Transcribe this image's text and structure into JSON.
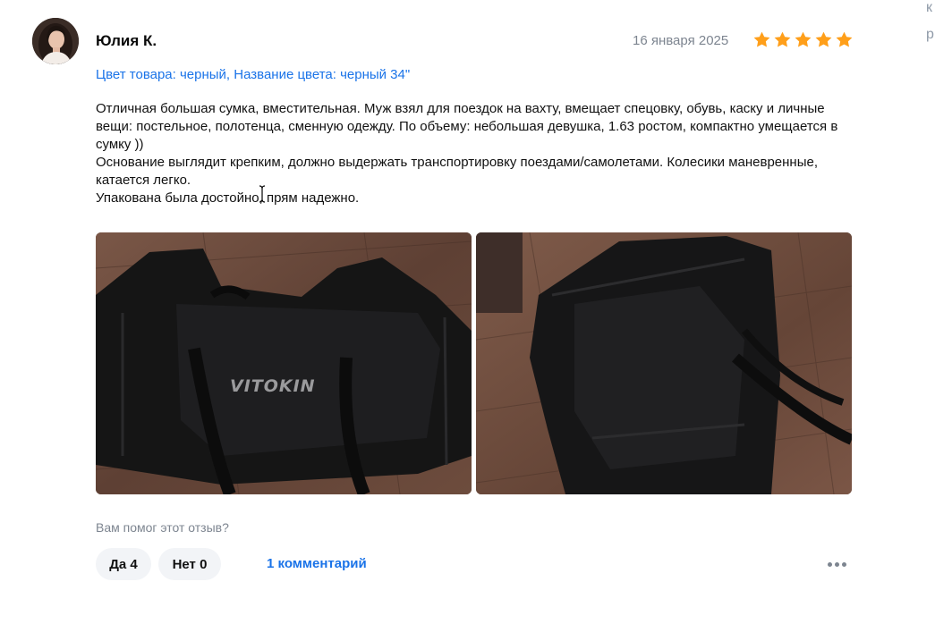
{
  "edge": {
    "line1": "к",
    "line2": "р"
  },
  "review": {
    "author": "Юлия К.",
    "date": "16 января 2025",
    "rating": 5,
    "star_color": "#ff9f1a",
    "variant": "Цвет товара: черный, Название цвета: черный 34\"",
    "text": {
      "p1": "Отличная большая сумка, вместительная. Муж взял для поездок на вахту, вмещает спецовку, обувь, каску и личные вещи: постельное, полотенца, сменную одежду. По объему: небольшая девушка, 1.63 ростом, компактно умещается в сумку ))",
      "p2": "Основание выглядит крепким, должно выдержать транспортировку поездами/самолетами. Колесики маневренные, катается легко.",
      "p3": "Упакована была достойно, прям надежно."
    },
    "photos": [
      {
        "brand_text": "VITOKIN"
      },
      {
        "brand_text": ""
      }
    ]
  },
  "feedback": {
    "question": "Вам помог этот отзыв?",
    "yes_label": "Да 4",
    "no_label": "Нет 0",
    "comments_label": "1 комментарий",
    "more_icon": "more-dots-icon"
  },
  "colors": {
    "link": "#1a73e8",
    "muted": "#7d8590",
    "pill_bg": "#f2f4f7"
  }
}
